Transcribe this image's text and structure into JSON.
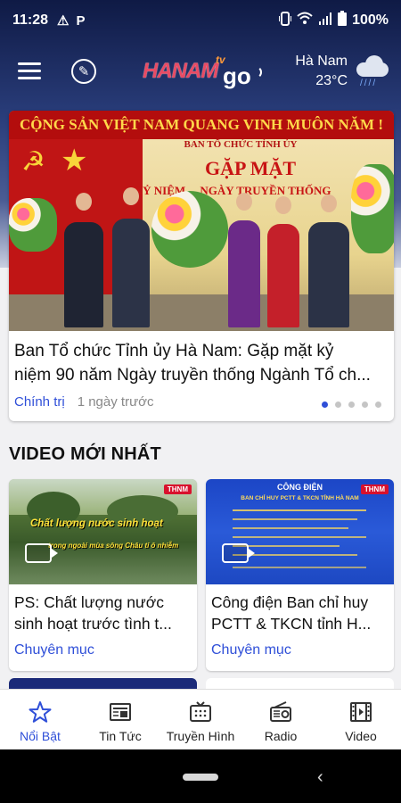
{
  "status_bar": {
    "time": "11:28",
    "icons": [
      "alert-icon",
      "p-icon"
    ],
    "battery": "100%",
    "system_icons": [
      "vibrate-icon",
      "wifi-icon",
      "signal-icon",
      "battery-icon"
    ]
  },
  "header": {
    "logo_main": "HANAM",
    "logo_tv": "tv",
    "logo_go": "go",
    "weather_city": "Hà Nam",
    "weather_temp": "23°C",
    "weather_icon": "rain-cloud-icon"
  },
  "hero": {
    "image_banner": "CỘNG SẢN VIỆT NAM QUANG VINH MUÔN NĂM !",
    "image_org": "BAN TỔ CHỨC TỈNH ỦY",
    "image_big": "GẶP MẶT",
    "image_sub": "KỶ NIỆM ... NGÀY TRUYỀN THỐNG",
    "title_line1": "Ban Tổ chức Tỉnh ủy Hà Nam: Gặp mặt kỷ",
    "title_line2": "niệm 90 năm Ngày truyền thống Ngành Tổ ch...",
    "category": "Chính trị",
    "time": "1 ngày trước",
    "carousel_pages": 5,
    "carousel_active": 1
  },
  "section": {
    "title": "VIDEO MỚI NHẤT"
  },
  "videos": [
    {
      "thumb_text_1": "Chất lượng nước sinh hoạt",
      "thumb_text_2": "trong ngoài mùa sông Châu tỉ ô nhiễm",
      "badge": "THNM",
      "title_line1": "PS: Chất lượng nước",
      "title_line2": "sinh hoạt trước tình t...",
      "category": "Chuyên mục"
    },
    {
      "thumb_heading": "CÔNG ĐIỆN",
      "thumb_sub": "BAN CHỈ HUY PCTT & TKCN TỈNH HÀ NAM",
      "badge": "THNM",
      "title_line1": "Công điện Ban chỉ huy",
      "title_line2": "PCTT & TKCN tỉnh H...",
      "category": "Chuyên mục"
    }
  ],
  "bottom_nav": [
    {
      "label": "Nổi Bật",
      "icon": "star-icon",
      "active": true
    },
    {
      "label": "Tin Tức",
      "icon": "newspaper-icon",
      "active": false
    },
    {
      "label": "Truyền Hình",
      "icon": "tv-icon",
      "active": false
    },
    {
      "label": "Radio",
      "icon": "radio-icon",
      "active": false
    },
    {
      "label": "Video",
      "icon": "film-icon",
      "active": false
    }
  ],
  "colors": {
    "accent": "#2f4fd8",
    "header_dark": "#0f1a45",
    "logo_red": "#e84b64",
    "background": "#f1f1f3"
  }
}
